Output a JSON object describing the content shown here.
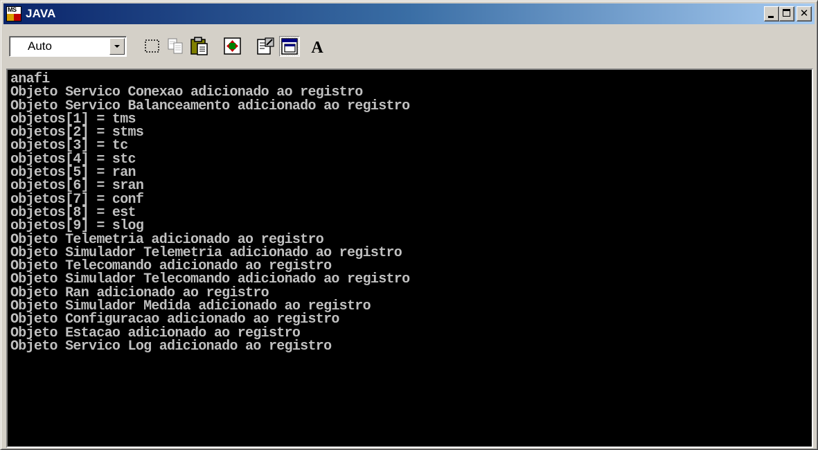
{
  "window": {
    "title": "JAVA",
    "app_icon_text": "MS"
  },
  "toolbar": {
    "font_size_value": "Auto",
    "buttons": [
      {
        "name": "mark-icon"
      },
      {
        "name": "copy-icon"
      },
      {
        "name": "paste-icon"
      },
      {
        "name": "fullscreen-icon"
      },
      {
        "name": "properties-icon"
      },
      {
        "name": "background-icon",
        "pressed": true
      },
      {
        "name": "font-icon"
      }
    ]
  },
  "console": {
    "lines": [
      "anafi",
      "Objeto Servico Conexao adicionado ao registro",
      "Objeto Servico Balanceamento adicionado ao registro",
      "objetos[1] = tms",
      "objetos[2] = stms",
      "objetos[3] = tc",
      "objetos[4] = stc",
      "objetos[5] = ran",
      "objetos[6] = sran",
      "objetos[7] = conf",
      "objetos[8] = est",
      "objetos[9] = slog",
      "Objeto Telemetria adicionado ao registro",
      "Objeto Simulador Telemetria adicionado ao registro",
      "Objeto Telecomando adicionado ao registro",
      "Objeto Simulador Telecomando adicionado ao registro",
      "Objeto Ran adicionado ao registro",
      "Objeto Simulador Medida adicionado ao registro",
      "Objeto Configuracao adicionado ao registro",
      "Objeto Estacao adicionado ao registro",
      "Objeto Servico Log adicionado ao registro"
    ]
  },
  "colors": {
    "titlebar_start": "#0a246a",
    "titlebar_end": "#a6caf0",
    "console_bg": "#000000",
    "console_text": "#c0c0c0",
    "chrome": "#d4d0c8"
  }
}
